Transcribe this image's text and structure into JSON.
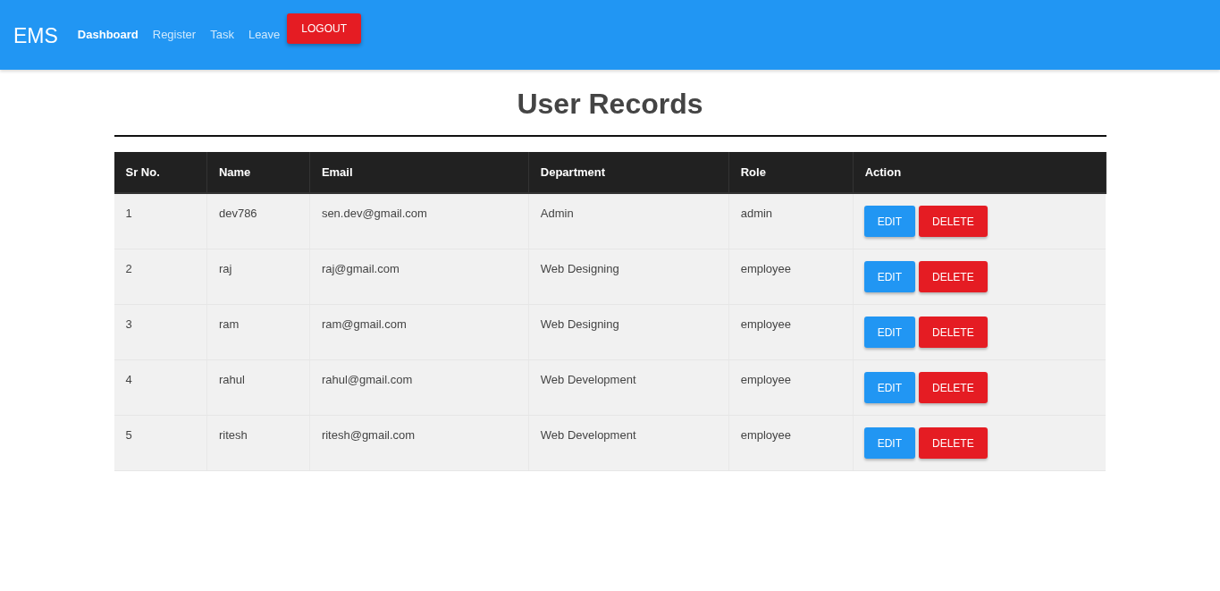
{
  "navbar": {
    "brand": "EMS",
    "links": [
      {
        "label": "Dashboard",
        "selected": true
      },
      {
        "label": "Register",
        "selected": false
      },
      {
        "label": "Task",
        "selected": false
      },
      {
        "label": "Leave",
        "selected": false
      }
    ],
    "logout": "LOGOUT"
  },
  "page": {
    "title": "User Records"
  },
  "table": {
    "columns": [
      "Sr No.",
      "Name",
      "Email",
      "Department",
      "Role",
      "Action"
    ],
    "rows": [
      {
        "sr_no": "1",
        "name": "dev786",
        "email": "sen.dev@gmail.com",
        "department": "Admin",
        "role": "admin",
        "actions": [
          "EDIT",
          "DELETE"
        ]
      },
      {
        "sr_no": "2",
        "name": "raj",
        "email": "raj@gmail.com",
        "department": "Web Designing",
        "role": "employee",
        "actions": [
          "EDIT",
          "DELETE"
        ]
      },
      {
        "sr_no": "3",
        "name": "ram",
        "email": "ram@gmail.com",
        "department": "Web Designing",
        "role": "employee",
        "actions": [
          "EDIT",
          "DELETE"
        ]
      },
      {
        "sr_no": "4",
        "name": "rahul",
        "email": "rahul@gmail.com",
        "department": "Web Development",
        "role": "employee",
        "actions": [
          "EDIT",
          "DELETE"
        ]
      },
      {
        "sr_no": "5",
        "name": "ritesh",
        "email": "ritesh@gmail.com",
        "department": "Web Development",
        "role": "employee",
        "actions": [
          "EDIT",
          "DELETE"
        ]
      }
    ]
  }
}
